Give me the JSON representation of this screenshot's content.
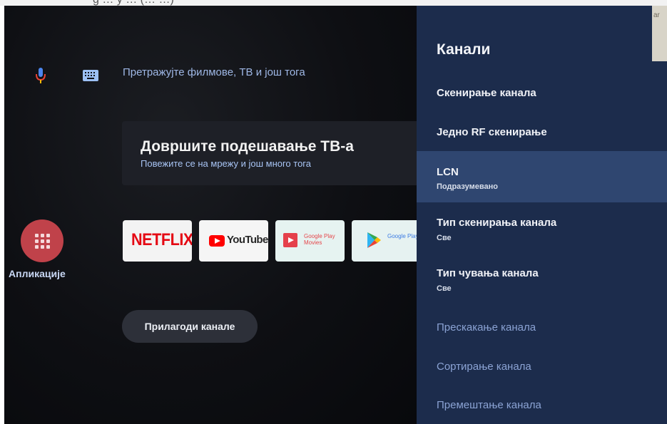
{
  "top_strip_text": "g … y … (… …)",
  "search": {
    "placeholder": "Претражујте филмове, ТВ и још тога"
  },
  "setup_card": {
    "title": "Довршите подешавање ТВ-а",
    "subtitle": "Повежите се на мрежу и још много тога"
  },
  "apps": {
    "label": "Апликације"
  },
  "tiles": [
    {
      "name": "netflix",
      "text": "NETFLIX"
    },
    {
      "name": "youtube",
      "text": "YouTube"
    },
    {
      "name": "google-play-movies",
      "text": "Google Play Movies"
    },
    {
      "name": "google-play-store",
      "text": "Google Play Store"
    }
  ],
  "customize_button": "Прилагоди канале",
  "preview_text": "ar",
  "panel": {
    "title": "Канали",
    "items": [
      {
        "label": "Скенирање канала"
      },
      {
        "label": "Једно RF скенирање"
      },
      {
        "label": "LCN",
        "sub": "Подразумевано",
        "selected": true
      },
      {
        "label": "Тип скенирања канала",
        "sub": "Све"
      },
      {
        "label": "Тип чувања канала",
        "sub": "Све"
      },
      {
        "label": "Прескакање канала",
        "disabled": true
      },
      {
        "label": "Сортирање канала",
        "disabled": true
      },
      {
        "label": "Премештање канала",
        "disabled": true
      }
    ]
  },
  "colors": {
    "panel_bg": "#1c2c4c",
    "panel_selected": "#2f4670",
    "apps_circle": "#c0424a",
    "accent_text": "#9fb8e6"
  }
}
